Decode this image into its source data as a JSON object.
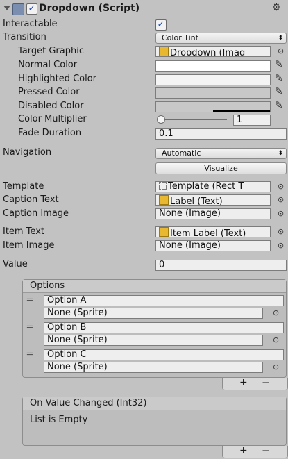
{
  "component": {
    "title": "Dropdown (Script)",
    "enabled": true
  },
  "props": {
    "interactable": {
      "label": "Interactable",
      "checked": true
    },
    "transition": {
      "label": "Transition",
      "value": "Color Tint"
    },
    "target_graphic": {
      "label": "Target Graphic",
      "value": "Dropdown (Imag"
    },
    "normal_color": {
      "label": "Normal Color",
      "color": "#ffffff"
    },
    "highlighted_color": {
      "label": "Highlighted Color",
      "color": "#f5f5f5"
    },
    "pressed_color": {
      "label": "Pressed Color",
      "color": "#c8c8c8"
    },
    "disabled_color": {
      "label": "Disabled Color",
      "color": "#c8c8c8"
    },
    "color_multiplier": {
      "label": "Color Multiplier",
      "value": "1"
    },
    "fade_duration": {
      "label": "Fade Duration",
      "value": "0.1"
    },
    "navigation": {
      "label": "Navigation",
      "value": "Automatic",
      "visualize_label": "Visualize"
    },
    "template": {
      "label": "Template",
      "value": "Template (Rect T"
    },
    "caption_text": {
      "label": "Caption Text",
      "value": "Label (Text)"
    },
    "caption_image": {
      "label": "Caption Image",
      "value": "None (Image)"
    },
    "item_text": {
      "label": "Item Text",
      "value": "Item Label (Text)"
    },
    "item_image": {
      "label": "Item Image",
      "value": "None (Image)"
    },
    "value": {
      "label": "Value",
      "value": "0"
    }
  },
  "options": {
    "header": "Options",
    "items": [
      {
        "text": "Option A",
        "sprite": "None (Sprite)"
      },
      {
        "text": "Option B",
        "sprite": "None (Sprite)"
      },
      {
        "text": "Option C",
        "sprite": "None (Sprite)"
      }
    ]
  },
  "on_value_changed": {
    "header": "On Value Changed (Int32)",
    "empty_text": "List is Empty"
  },
  "list_buttons": {
    "add": "+",
    "remove": "−"
  },
  "icons": {
    "fold": "fold-arrow-icon",
    "component": "component-icon",
    "gear": "gear-icon",
    "picker": "eyedropper-icon",
    "target": "object-picker-icon"
  }
}
